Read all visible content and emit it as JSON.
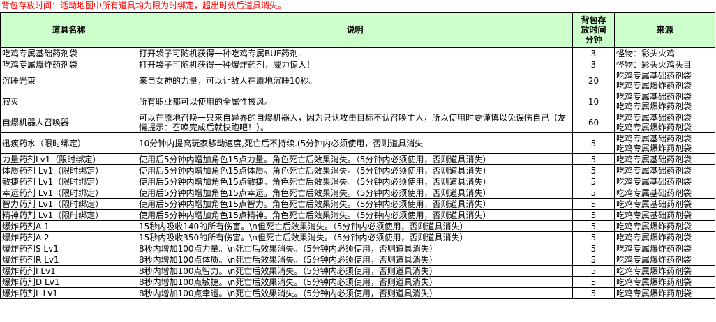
{
  "notice": "背包存放时间：活动地图中所有道具均为限为时绑定，超出时效后道具消失。",
  "headers": {
    "name": "道具名称",
    "desc": "说明",
    "time_lines": [
      "背包存",
      "放时间",
      "分钟"
    ],
    "source": "来源"
  },
  "rows": [
    {
      "name": "吃鸡专属基础药剂袋",
      "desc": "打开袋子可随机获得一种吃鸡专属BUF药剂.",
      "duration": "3",
      "source": [
        "怪物：彩头火鸡"
      ]
    },
    {
      "name": "吃鸡专属爆炸药剂袋",
      "desc": "打开袋子可随机获得一种爆炸药剂，威力惊人！",
      "duration": "3",
      "source": [
        "怪物：彩头火鸡头目"
      ]
    },
    {
      "name": "沉睡光束",
      "desc": "来自女神的力量，可以让敌人在原地沉睡10秒。",
      "duration": "20",
      "source": [
        "吃鸡专属基础药剂袋",
        "吃鸡专属爆炸药剂袋"
      ],
      "tall": true
    },
    {
      "name": "寂灭",
      "desc": "所有职业都可以使用的全属性披风。",
      "duration": "10",
      "source": [
        "吃鸡专属基础药剂袋",
        "吃鸡专属爆炸药剂袋"
      ],
      "tall": true
    },
    {
      "name": "自爆机器人召唤器",
      "desc": "可以在原地召唤一只来自异界的自爆机器人，因为只认攻击目标不认召唤主人，所以使用时要谨慎以免误伤自己（友情提示：召唤完成后就快跑吧！）。",
      "duration": "60",
      "source": [
        "吃鸡专属基础药剂袋",
        "吃鸡专属爆炸药剂袋"
      ],
      "tall": true
    },
    {
      "name": "迅疾药水（限时绑定）",
      "desc": "10分钟内提高玩家移动速度,死亡后不持续.(5分钟内必须使用，否则道具消失",
      "duration": "5",
      "source": [
        "吃鸡专属基础药剂袋",
        "吃鸡专属爆炸药剂袋"
      ],
      "tall": true
    },
    {
      "name": "力量药剂Lv1（限时绑定）",
      "desc": "使用后5分钟内增加角色15点力量。角色死亡后效果消失。（5分钟内必须使用，否则道具消失）",
      "duration": "5",
      "source": [
        "吃鸡专属基础药剂袋"
      ]
    },
    {
      "name": "体质药剂 Lv1（限时绑定）",
      "desc": "使用后5分钟内增加角色15点体质。角色死亡后效果消失。（5分钟内必须使用，否则道具消失）",
      "duration": "5",
      "source": [
        "吃鸡专属基础药剂袋"
      ]
    },
    {
      "name": "敏捷药剂 Lv1（限时绑定）",
      "desc": "使用后5分钟内增加角色15点敏捷。角色死亡后效果消失。（5分钟内必须使用，否则道具消失）",
      "duration": "5",
      "source": [
        "吃鸡专属基础药剂袋"
      ]
    },
    {
      "name": "幸运药剂 Lv1（限时绑定）",
      "desc": "使用后5分钟内增加角色15点幸运。角色死亡后效果消失。（5分钟内必须使用，否则道具消失）",
      "duration": "5",
      "source": [
        "吃鸡专属基础药剂袋"
      ]
    },
    {
      "name": "智力药剂 Lv1（限时绑定）",
      "desc": "使用后5分钟内增加角色15点智力。角色死亡后效果消失。（5分钟内必须使用，否则道具消失）",
      "duration": "5",
      "source": [
        "吃鸡专属基础药剂袋"
      ]
    },
    {
      "name": "精神药剂 Lv1（限时绑定）",
      "desc": "使用后5分钟内增加角色15点精神。角色死亡后效果消失。（5分钟内必须使用，否则道具消失）",
      "duration": "5",
      "source": [
        "吃鸡专属基础药剂袋"
      ]
    },
    {
      "name": "爆炸药剂A 1",
      "desc": "15秒内吸收140的所有伤害。\\n但死亡后效果消失。（5分钟内必须使用，否则道具消失）",
      "duration": "5",
      "source": [
        "吃鸡专属爆炸药剂袋"
      ]
    },
    {
      "name": "爆炸药剂A 2",
      "desc": "15秒内吸收350的所有伤害。\\n但死亡后效果消失。（5分钟内必须使用，否则道具消失）",
      "duration": "5",
      "source": [
        "吃鸡专属爆炸药剂袋"
      ]
    },
    {
      "name": "爆炸药剂S Lv1",
      "desc": "8秒内增加100点力量。\\n死亡后效果消失。（5分钟内必须使用，否则道具消失）",
      "duration": "5",
      "source": [
        "吃鸡专属爆炸药剂袋"
      ]
    },
    {
      "name": "爆炸药剂R Lv1",
      "desc": "8秒内增加100点体质。\\n死亡后效果消失。（5分钟内必须使用，否则道具消失）",
      "duration": "5",
      "source": [
        "吃鸡专属爆炸药剂袋"
      ]
    },
    {
      "name": "爆炸药剂I Lv1",
      "desc": "8秒内增加100点智力。\\n死亡后效果消失。（5分钟内必须使用，否则道具消失）",
      "duration": "5",
      "source": [
        "吃鸡专属爆炸药剂袋"
      ]
    },
    {
      "name": "爆炸药剂D Lv1",
      "desc": "8秒内增加100点敏捷。\\n死亡后效果消失。（5分钟内必须使用，否则道具消失）",
      "duration": "5",
      "source": [
        "吃鸡专属爆炸药剂袋"
      ]
    },
    {
      "name": "爆炸药剂L Lv1",
      "desc": "8秒内增加100点幸运。\\n死亡后效果消失。（5分钟内必须使用，否则道具消失）",
      "duration": "5",
      "source": [
        "吃鸡专属爆炸药剂袋"
      ]
    }
  ]
}
